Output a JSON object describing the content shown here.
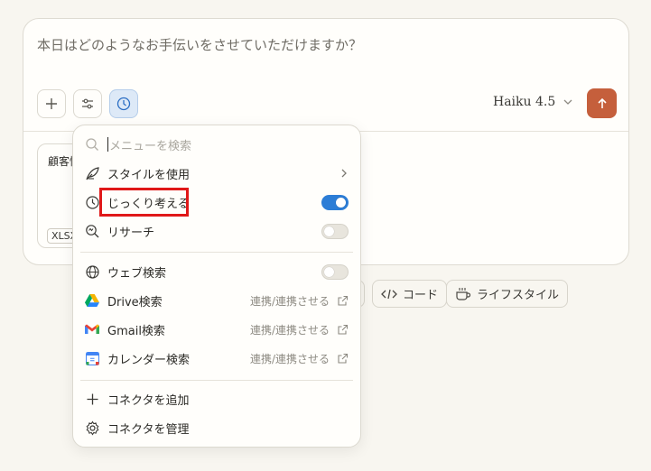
{
  "composer": {
    "placeholder": "本日はどのようなお手伝いをさせていただけますか？",
    "model_label": "Haiku 4.5",
    "file_name": "顧客情",
    "file_type": "XLSX"
  },
  "chips": [
    {
      "label": "コード",
      "icon": "code-icon"
    },
    {
      "label": "ライフスタイル",
      "icon": "coffee-icon"
    }
  ],
  "menu": {
    "search_placeholder": "メニューを検索",
    "items": [
      {
        "label": "スタイルを使用",
        "icon": "quill-icon",
        "control": "chevron"
      },
      {
        "label": "じっくり考える",
        "icon": "clock-icon",
        "control": "toggle",
        "on": true
      },
      {
        "label": "リサーチ",
        "icon": "research-icon",
        "control": "toggle",
        "on": false
      },
      {
        "label": "ウェブ検索",
        "icon": "globe-icon",
        "control": "toggle",
        "on": false
      },
      {
        "label": "Drive検索",
        "icon": "google-drive-icon",
        "control": "connect",
        "action": "連携/連携させる"
      },
      {
        "label": "Gmail検索",
        "icon": "gmail-icon",
        "control": "connect",
        "action": "連携/連携させる"
      },
      {
        "label": "カレンダー検索",
        "icon": "google-calendar-icon",
        "control": "connect",
        "action": "連携/連携させる"
      },
      {
        "label": "コネクタを追加",
        "icon": "plus-icon"
      },
      {
        "label": "コネクタを管理",
        "icon": "gear-icon"
      }
    ]
  },
  "colors": {
    "accent": "#c55f3c",
    "toggle_on": "#2c7dd6",
    "highlight": "#e01818"
  }
}
